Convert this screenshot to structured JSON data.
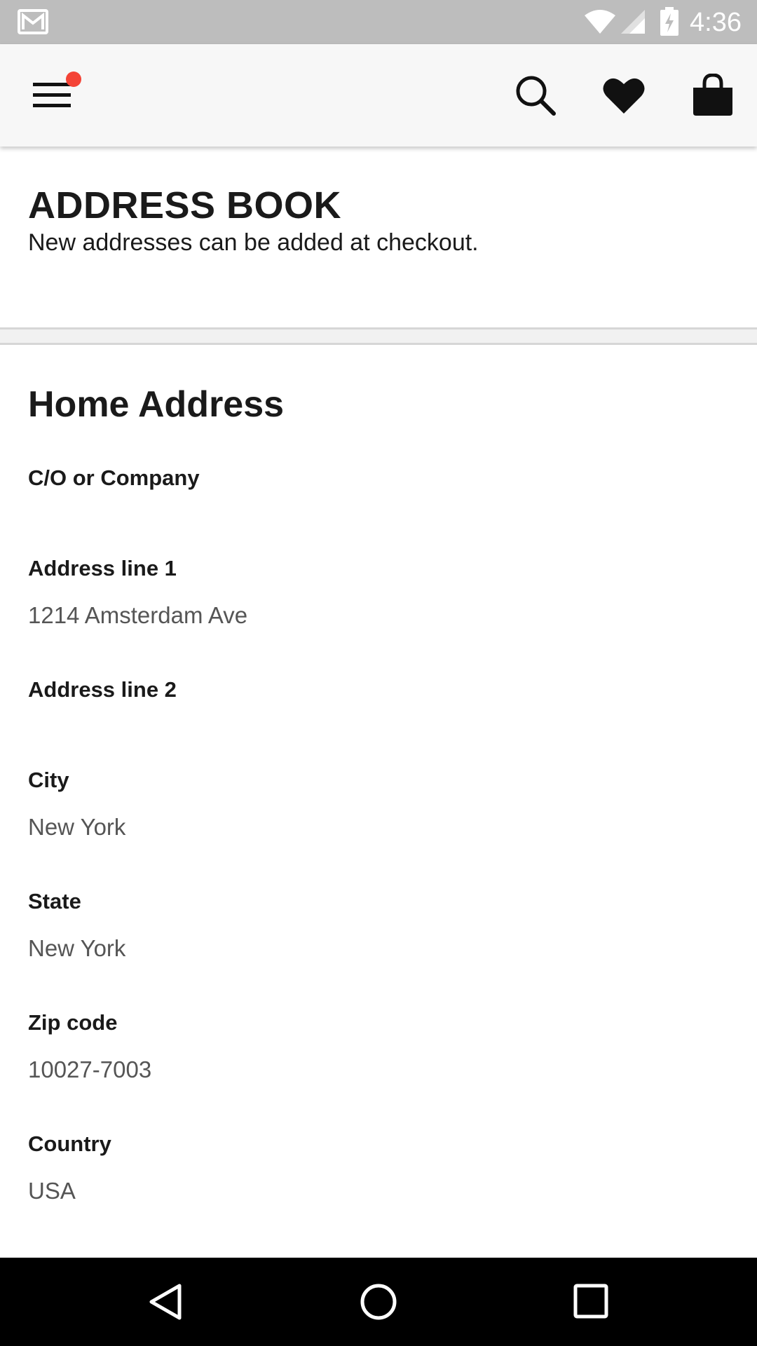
{
  "status_bar": {
    "time": "4:36",
    "icons": [
      "gmail-icon",
      "wifi-icon",
      "signal-icon",
      "battery-charging-icon"
    ]
  },
  "app_bar": {
    "icons": [
      "menu-icon",
      "search-icon",
      "heart-icon",
      "shopping-bag-icon"
    ],
    "notification_dot_color": "#f44336"
  },
  "header": {
    "title": "ADDRESS BOOK",
    "subtitle": "New addresses can be added at checkout."
  },
  "address": {
    "section_title": "Home Address",
    "fields": [
      {
        "label": "C/O or Company",
        "value": ""
      },
      {
        "label": "Address line 1",
        "value": "1214 Amsterdam Ave"
      },
      {
        "label": "Address line 2",
        "value": ""
      },
      {
        "label": "City",
        "value": "New York"
      },
      {
        "label": "State",
        "value": "New York"
      },
      {
        "label": "Zip code",
        "value": "10027-7003"
      },
      {
        "label": "Country",
        "value": "USA"
      }
    ]
  },
  "nav_bar": {
    "icons": [
      "back-icon",
      "home-icon",
      "recent-apps-icon"
    ]
  }
}
